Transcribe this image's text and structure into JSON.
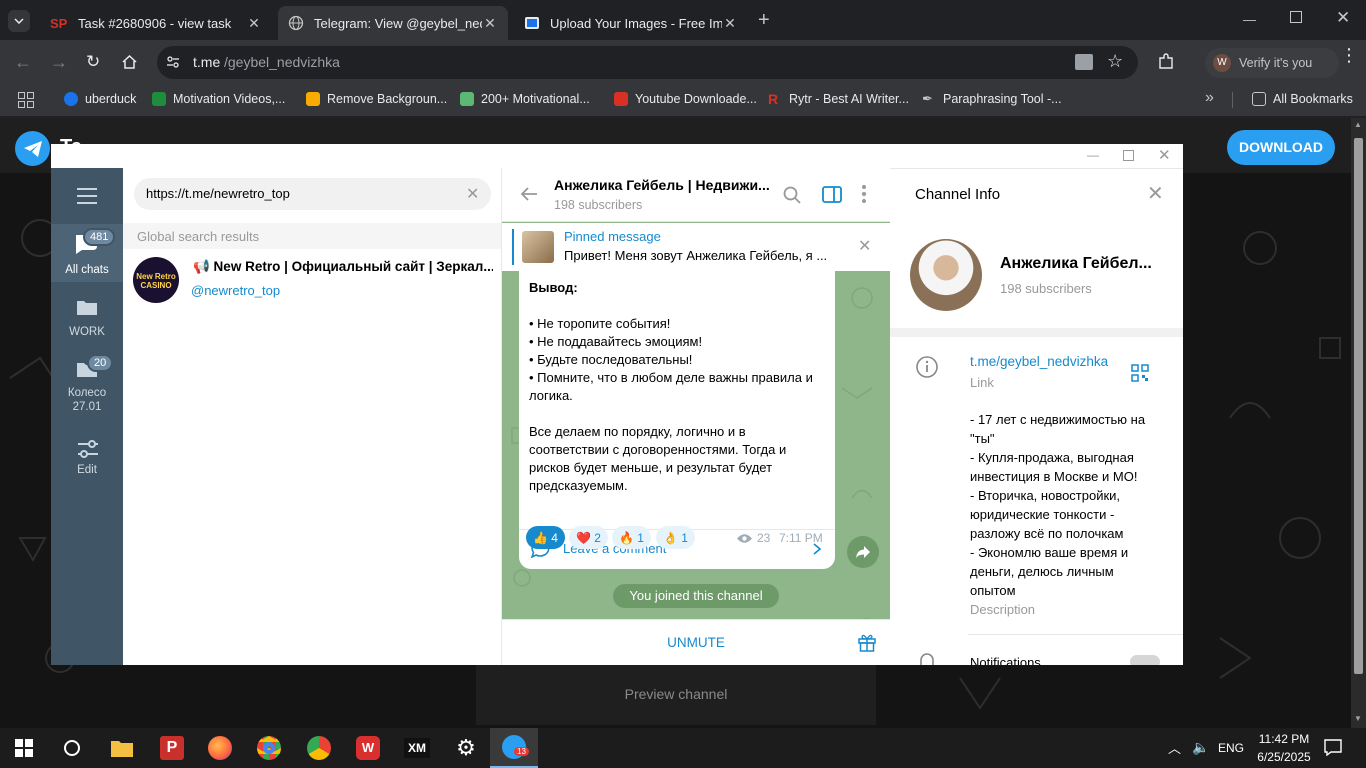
{
  "browser": {
    "tabs": [
      {
        "title": "Task #2680906 - view task",
        "favicon": "sp-favicon",
        "active": false
      },
      {
        "title": "Telegram: View @geybel_nedvizhka",
        "favicon": "globe-favicon",
        "active": true
      },
      {
        "title": "Upload Your Images - Free Image",
        "favicon": "image-favicon",
        "active": false
      }
    ],
    "url_host": "t.me",
    "url_path": "/geybel_nedvizhka",
    "profile_label": "Verify it's you",
    "bookmarks": [
      "uberduck",
      "Motivation Videos,...",
      "Remove Backgroun...",
      "200+ Motivational...",
      "Youtube Downloade...",
      "Rytr - Best AI Writer...",
      "Paraphrasing Tool -..."
    ],
    "all_bookmarks": "All Bookmarks"
  },
  "webpage": {
    "logo_text": "Te",
    "download_button": "DOWNLOAD",
    "preview_channel": "Preview channel"
  },
  "telegram": {
    "folders": [
      {
        "label": "All chats",
        "badge": "481"
      },
      {
        "label": "WORK",
        "badge": ""
      },
      {
        "label": "Колесо 27.01",
        "badge": "20"
      },
      {
        "label": "Edit",
        "badge": ""
      }
    ],
    "search": {
      "value": "https://t.me/newretro_top",
      "section_header": "Global search results",
      "result_title": "📢 New Retro | Официальный сайт | Зеркал...",
      "result_username": "@newretro_top",
      "result_avatar_text": "New Retro CASINO"
    },
    "chat": {
      "title": "Анжелика Гейбель | Недвижи...",
      "subscribers": "198 subscribers",
      "pinned_label": "Pinned message",
      "pinned_text": "Привет! Меня зовут Анжелика Гейбель, я ...",
      "message": {
        "heading": "Вывод:",
        "bullets": [
          "Не торопите события!",
          "Не поддавайтесь эмоциям!",
          "Будьте последовательны!",
          "Помните, что в любом деле  важны правила и логика."
        ],
        "paragraph": "Все делаем по порядку, логично и в соответствии с договоренностями. Тогда и рисков будет меньше, и результат будет предсказуемым.",
        "reactions": [
          {
            "emoji": "👍",
            "count": "4"
          },
          {
            "emoji": "❤️",
            "count": "2"
          },
          {
            "emoji": "🔥",
            "count": "1"
          },
          {
            "emoji": "👌",
            "count": "1"
          }
        ],
        "views": "23",
        "time": "7:11 PM",
        "comment_label": "Leave a comment"
      },
      "joined_notice": "You joined this channel",
      "unmute": "UNMUTE"
    },
    "info": {
      "header": "Channel Info",
      "name": "Анжелика Гейбел...",
      "subscribers": "198 subscribers",
      "link": "t.me/geybel_nedvizhka",
      "link_caption": "Link",
      "description": [
        "- 17 лет с недвижимостью на \"ты\"",
        "- Купля-продажа, выгодная инвестиция в Москве и МО!",
        "- Вторичка, новостройки, юридические тонкости - разложу всё по полочкам",
        "- Экономлю ваше время и деньги, делюсь личным опытом"
      ],
      "description_caption": "Description",
      "notifications": "Notifications"
    }
  },
  "taskbar": {
    "language": "ENG",
    "time": "11:42 PM",
    "date": "6/25/2025",
    "telegram_badge": "13"
  },
  "colors": {
    "accent": "#168acd",
    "rail": "#405566",
    "download": "#2a9ef1",
    "chat_bg": "#8fb68a"
  }
}
